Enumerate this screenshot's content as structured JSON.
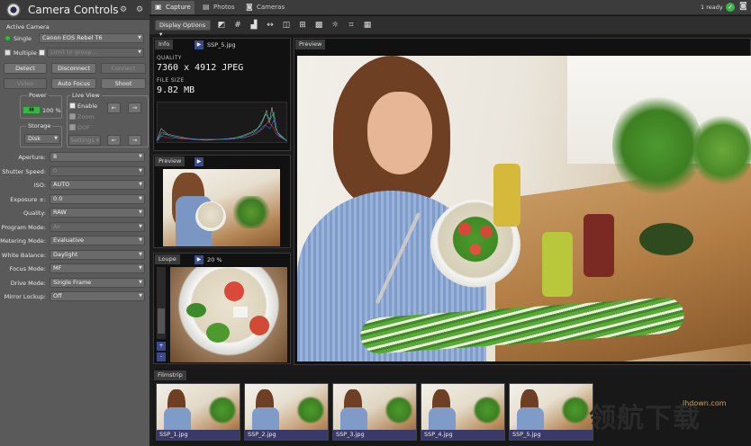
{
  "app": {
    "title": "Camera Controls"
  },
  "active_camera": {
    "label": "Active Camera",
    "single_label": "Single",
    "multiple_label": "Multiple",
    "camera_select": "Canon EOS Rebel T6",
    "group_placeholder": "Limit to group..."
  },
  "buttons": {
    "detect": "Detect",
    "disconnect": "Disconnect",
    "connect": "Connect",
    "video": "Video",
    "auto_focus": "Auto Focus",
    "shoot": "Shoot"
  },
  "power": {
    "label": "Power",
    "percent": "100 %",
    "level": 1.0
  },
  "live_view": {
    "label": "Live View",
    "enable": "Enable",
    "zoom": "Zoom",
    "dof": "DOF",
    "settings": "Settings"
  },
  "storage": {
    "label": "Storage",
    "value": "Disk"
  },
  "settings": [
    {
      "label": "Aperture:",
      "value": "8",
      "enabled": true
    },
    {
      "label": "Shutter Speed:",
      "value": "0",
      "enabled": false
    },
    {
      "label": "ISO:",
      "value": "AUTO",
      "enabled": true
    },
    {
      "label": "Exposure ±:",
      "value": "0.0",
      "enabled": true
    },
    {
      "label": "Quality:",
      "value": "RAW",
      "enabled": true
    },
    {
      "label": "Program Mode:",
      "value": "Av",
      "enabled": false
    },
    {
      "label": "Metering Mode:",
      "value": "Evaluative",
      "enabled": true
    },
    {
      "label": "White Balance:",
      "value": "Daylight",
      "enabled": true
    },
    {
      "label": "Focus Mode:",
      "value": "MF",
      "enabled": true
    },
    {
      "label": "Drive Mode:",
      "value": "Single Frame",
      "enabled": true
    },
    {
      "label": "Mirror Lockup:",
      "value": "Off",
      "enabled": true
    }
  ],
  "tabs": [
    {
      "label": "Capture",
      "icon": "capture-icon"
    },
    {
      "label": "Photos",
      "icon": "photos-icon"
    },
    {
      "label": "Cameras",
      "icon": "cameras-icon"
    }
  ],
  "status": {
    "text": "1 ready"
  },
  "toolbar": {
    "display_options": "Display Options"
  },
  "info": {
    "tab": "Info",
    "filename": "SSP_5.jpg",
    "quality_label": "QUALITY",
    "dimensions": "7360 x 4912 JPEG",
    "size_label": "FILE SIZE",
    "size": "9.82 MB"
  },
  "preview_small": {
    "tab": "Preview"
  },
  "loupe": {
    "tab": "Loupe",
    "zoom": "20 %",
    "plus": "+",
    "minus": "-"
  },
  "preview_main": {
    "tab": "Preview"
  },
  "filmstrip": {
    "tab": "Filmstrip",
    "items": [
      "SSP_1.jpg",
      "SSP_2.jpg",
      "SSP_3.jpg",
      "SSP_4.jpg",
      "SSP_5.jpg"
    ]
  },
  "watermark": {
    "text": "领航下载",
    "url": "lhdown.com"
  },
  "colors": {
    "accent_green": "#39b54a",
    "button_blue": "#3b4a8a"
  }
}
